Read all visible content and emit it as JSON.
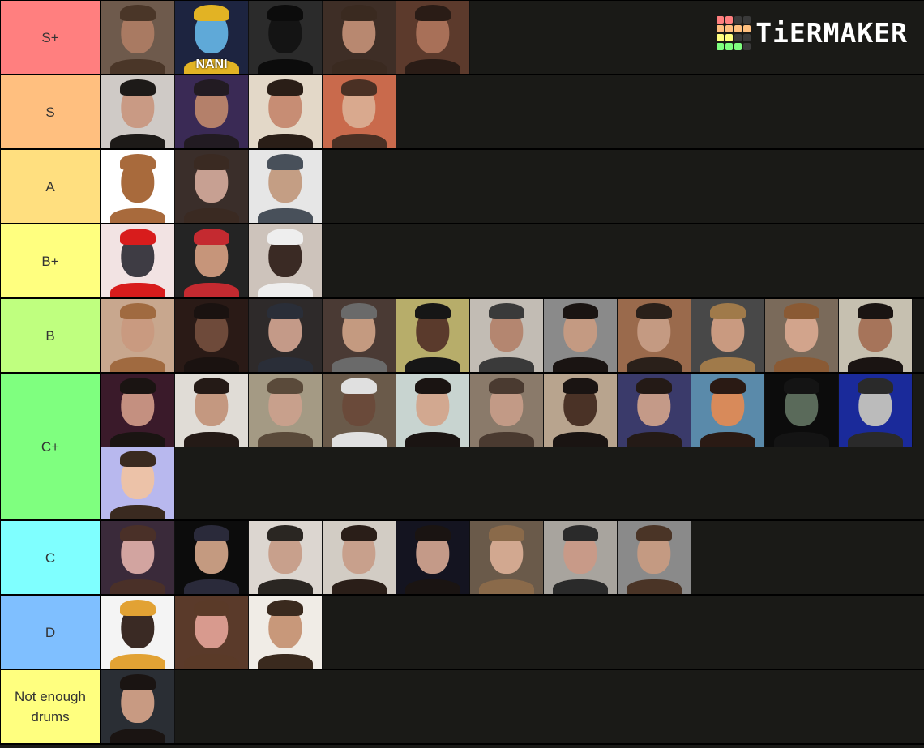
{
  "logo": {
    "text": "TiERMAKER",
    "grid_colors": [
      "#ff7f7f",
      "#ff7f7f",
      "#3a3a3a",
      "#3a3a3a",
      "#ffbf7f",
      "#ffbf7f",
      "#ffbf7f",
      "#ffbf7f",
      "#ffff7f",
      "#ffff7f",
      "#3a3a3a",
      "#3a3a3a",
      "#7fff7f",
      "#7fff7f",
      "#7fff7f",
      "#3a3a3a"
    ]
  },
  "tiers": [
    {
      "label": "S+",
      "color": "#ff7f7f",
      "items": [
        {
          "name": "long-hair-bearded-man",
          "bg": "#6e5a4c",
          "skin": "#a97a62",
          "hair": "#4a3628"
        },
        {
          "name": "nani-anime-character",
          "bg": "#1d2440",
          "skin": "#5fa9d8",
          "hair": "#e2b324",
          "caption": "NANI"
        },
        {
          "name": "dark-hooded-figure",
          "bg": "#2b2b2b",
          "skin": "#141414",
          "hair": "#0c0c0c"
        },
        {
          "name": "curly-hair-glasses-man",
          "bg": "#3e2e26",
          "skin": "#b88870",
          "hair": "#3a2a20"
        },
        {
          "name": "headphones-man",
          "bg": "#5c3a2c",
          "skin": "#a87058",
          "hair": "#2a1c16"
        }
      ]
    },
    {
      "label": "S",
      "color": "#ffbf7f",
      "items": [
        {
          "name": "beanie-shouting-man",
          "bg": "#cfcac6",
          "skin": "#c99a84",
          "hair": "#1d1a18"
        },
        {
          "name": "purple-lit-man",
          "bg": "#3a2a55",
          "skin": "#b4806a",
          "hair": "#221b22"
        },
        {
          "name": "shaggy-hair-face",
          "bg": "#e3d8c8",
          "skin": "#c78d74",
          "hair": "#2a1e17"
        },
        {
          "name": "bearded-mic-man",
          "bg": "#c96a4c",
          "skin": "#d9a98e",
          "hair": "#4a3024"
        }
      ]
    },
    {
      "label": "A",
      "color": "#ffdf7f",
      "items": [
        {
          "name": "potato-drawing",
          "bg": "#ffffff",
          "skin": "#a86a3c",
          "hair": "#a86a3c"
        },
        {
          "name": "curly-glasses-boy",
          "bg": "#3a2e2a",
          "skin": "#c7a092",
          "hair": "#3a2a22"
        },
        {
          "name": "bandana-man-transparent",
          "bg": "#e6e6e6",
          "skin": "#c49e84",
          "hair": "#48505a"
        }
      ]
    },
    {
      "label": "B+",
      "color": "#ffff7f",
      "items": [
        {
          "name": "red-outline-face",
          "bg": "#f2e3e3",
          "skin": "#3e3c44",
          "hair": "#d81c1c"
        },
        {
          "name": "red-bandana-man",
          "bg": "#242424",
          "skin": "#c6957a",
          "hair": "#c42a30"
        },
        {
          "name": "shower-cap-man",
          "bg": "#cdc3bb",
          "skin": "#3a2a24",
          "hair": "#eeeeee"
        }
      ]
    },
    {
      "label": "B",
      "color": "#bfff7f",
      "items": [
        {
          "name": "ginger-beard-man",
          "bg": "#c8a78e",
          "skin": "#c99a80",
          "hair": "#a06a40"
        },
        {
          "name": "screaming-singer",
          "bg": "#2a1a16",
          "skin": "#6e4a3a",
          "hair": "#1a1210"
        },
        {
          "name": "cap-headphones-man",
          "bg": "#2e2a2a",
          "skin": "#c49a88",
          "hair": "#2a2e38"
        },
        {
          "name": "grey-cap-grinning-man",
          "bg": "#4a3a34",
          "skin": "#c49a80",
          "hair": "#6a6a6a"
        },
        {
          "name": "black-beanie-man",
          "bg": "#b7ad6a",
          "skin": "#5a3a2c",
          "hair": "#161616"
        },
        {
          "name": "cap-bearded-man",
          "bg": "#c2bcb4",
          "skin": "#b48670",
          "hair": "#3a3a3a"
        },
        {
          "name": "eyes-closed-man",
          "bg": "#8a8a8a",
          "skin": "#c49a82",
          "hair": "#1a1412"
        },
        {
          "name": "brick-wall-man",
          "bg": "#9a6a4c",
          "skin": "#c49a82",
          "hair": "#2a201a"
        },
        {
          "name": "phone-glasses-man",
          "bg": "#484848",
          "skin": "#c99a80",
          "hair": "#a07a4a"
        },
        {
          "name": "curly-mic-man",
          "bg": "#7a6a5a",
          "skin": "#d2a48c",
          "hair": "#8a5a34"
        },
        {
          "name": "mic-covering-mouth-man",
          "bg": "#c6c0b0",
          "skin": "#a6745a",
          "hair": "#1a1412"
        }
      ]
    },
    {
      "label": "C+",
      "color": "#7fff7f",
      "items": [
        {
          "name": "bearded-laughing-man",
          "bg": "#3a1a2a",
          "skin": "#c49080",
          "hair": "#1a1412"
        },
        {
          "name": "eyes-closed-big-man",
          "bg": "#e0dcd6",
          "skin": "#c49880",
          "hair": "#241a16"
        },
        {
          "name": "buzzcut-smirk-man",
          "bg": "#a49a84",
          "skin": "#c8a08c",
          "hair": "#5a4a3a"
        },
        {
          "name": "tilted-cap-man",
          "bg": "#6a5a4a",
          "skin": "#6a4a3a",
          "hair": "#e0e0e0"
        },
        {
          "name": "surprised-glasses-man",
          "bg": "#c8d4d0",
          "skin": "#d2a890",
          "hair": "#1a1412"
        },
        {
          "name": "blurry-close-face",
          "bg": "#8a7a6a",
          "skin": "#c29a86",
          "hair": "#4a3a30"
        },
        {
          "name": "glasses-smiling-man",
          "bg": "#b8a48e",
          "skin": "#4a3226",
          "hair": "#1a1412"
        },
        {
          "name": "beatbox-stage-man",
          "bg": "#3a3a6a",
          "skin": "#c49a88",
          "hair": "#241a16"
        },
        {
          "name": "shocked-orange-lit-man",
          "bg": "#5a8aaa",
          "skin": "#d88a5a",
          "hair": "#2a1a14"
        },
        {
          "name": "dark-green-lit-man",
          "bg": "#0c0c0c",
          "skin": "#5a6a5a",
          "hair": "#141414"
        },
        {
          "name": "grayscale-mustache-man",
          "bg": "#1a2a9a",
          "skin": "#bbbbbb",
          "hair": "#2a2a2a"
        },
        {
          "name": "eyes-closed-woman",
          "bg": "#b8b8ee",
          "skin": "#ecc2a8",
          "hair": "#3a2a20"
        }
      ]
    },
    {
      "label": "C",
      "color": "#7fffff",
      "items": [
        {
          "name": "close-smirk-man",
          "bg": "#3a2a3a",
          "skin": "#d2a4a0",
          "hair": "#4a3028"
        },
        {
          "name": "thumbs-up-rapper",
          "bg": "#0c0c0c",
          "skin": "#c49a80",
          "hair": "#2a2a3a"
        },
        {
          "name": "beanie-glasses-man",
          "bg": "#dcd6d0",
          "skin": "#c8a08c",
          "hair": "#2a2622"
        },
        {
          "name": "floral-shirt-man",
          "bg": "#d2ccc4",
          "skin": "#c8a08c",
          "hair": "#2a1e18"
        },
        {
          "name": "glasses-mic-man",
          "bg": "#141420",
          "skin": "#c49a88",
          "hair": "#1a1412"
        },
        {
          "name": "car-smiling-boy",
          "bg": "#6a5a4a",
          "skin": "#d2a890",
          "hair": "#8a6a4a"
        },
        {
          "name": "round-glasses-bearded-man",
          "bg": "#a8a49e",
          "skin": "#c89a88",
          "hair": "#2a2a2a"
        },
        {
          "name": "white-sunglasses-man",
          "bg": "#8a8a8a",
          "skin": "#c49a82",
          "hair": "#4a3426"
        }
      ]
    },
    {
      "label": "D",
      "color": "#7fbfff",
      "items": [
        {
          "name": "colorful-hoodie-man-circle",
          "bg": "#f4f4f4",
          "skin": "#3a2a24",
          "hair": "#e2a234"
        },
        {
          "name": "close-up-smiling-boy",
          "bg": "#5a3a2a",
          "skin": "#d89a8e",
          "hair": "#5a3a28"
        },
        {
          "name": "mustache-smiling-man",
          "bg": "#f0ece6",
          "skin": "#c8987a",
          "hair": "#3a2a1e"
        }
      ]
    },
    {
      "label": "Not enough drums",
      "color": "#ffff7f",
      "items": [
        {
          "name": "glasses-man-night",
          "bg": "#2a2e34",
          "skin": "#c89a82",
          "hair": "#1a1412"
        }
      ]
    }
  ]
}
